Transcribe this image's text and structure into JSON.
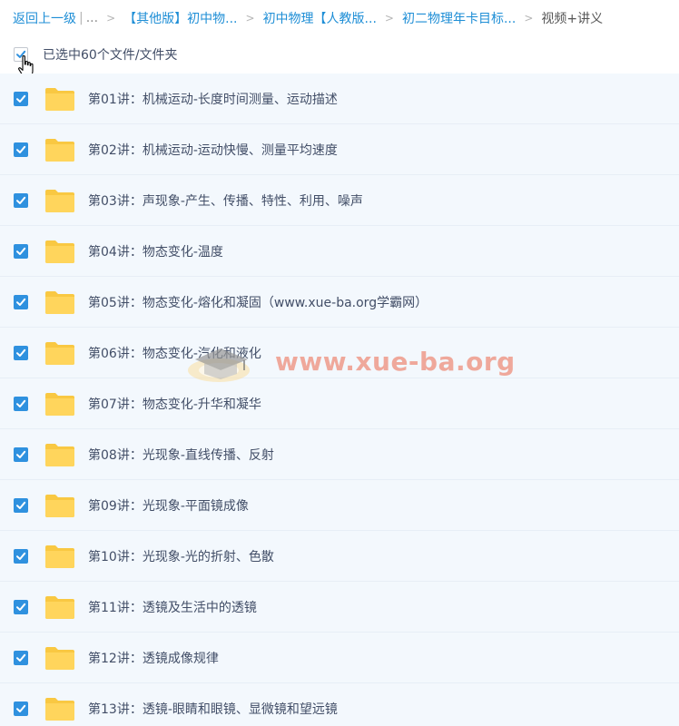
{
  "breadcrumb": {
    "back": "返回上一级",
    "pipe": "|",
    "ellipsis": "...",
    "separator": ">",
    "items": [
      "【其他版】初中物...",
      "初中物理【人教版...",
      "初二物理年卡目标..."
    ],
    "current": "视频+讲义"
  },
  "selection": {
    "label": "已选中60个文件/文件夹"
  },
  "watermark": {
    "text": "www.xue-ba.org"
  },
  "colors": {
    "link": "#1e8ed6",
    "checkbox": "#2f91df",
    "row_background": "#f3f8fd",
    "folder": "#ffd55c",
    "text": "#424e67"
  },
  "files": [
    {
      "name": "第01讲：机械运动-长度时间测量、运动描述",
      "checked": true,
      "icon": "folder-icon"
    },
    {
      "name": "第02讲：机械运动-运动快慢、测量平均速度",
      "checked": true,
      "icon": "folder-icon"
    },
    {
      "name": "第03讲：声现象-产生、传播、特性、利用、噪声",
      "checked": true,
      "icon": "folder-icon"
    },
    {
      "name": "第04讲：物态变化-温度",
      "checked": true,
      "icon": "folder-icon"
    },
    {
      "name": "第05讲：物态变化-熔化和凝固（www.xue-ba.org学霸网）",
      "checked": true,
      "icon": "folder-icon"
    },
    {
      "name": "第06讲：物态变化-汽化和液化",
      "checked": true,
      "icon": "folder-icon"
    },
    {
      "name": "第07讲：物态变化-升华和凝华",
      "checked": true,
      "icon": "folder-icon"
    },
    {
      "name": "第08讲：光现象-直线传播、反射",
      "checked": true,
      "icon": "folder-icon"
    },
    {
      "name": "第09讲：光现象-平面镜成像",
      "checked": true,
      "icon": "folder-icon"
    },
    {
      "name": "第10讲：光现象-光的折射、色散",
      "checked": true,
      "icon": "folder-icon"
    },
    {
      "name": "第11讲：透镜及生活中的透镜",
      "checked": true,
      "icon": "folder-icon"
    },
    {
      "name": "第12讲：透镜成像规律",
      "checked": true,
      "icon": "folder-icon"
    },
    {
      "name": "第13讲：透镜-眼睛和眼镜、显微镜和望远镜",
      "checked": true,
      "icon": "folder-icon"
    }
  ]
}
